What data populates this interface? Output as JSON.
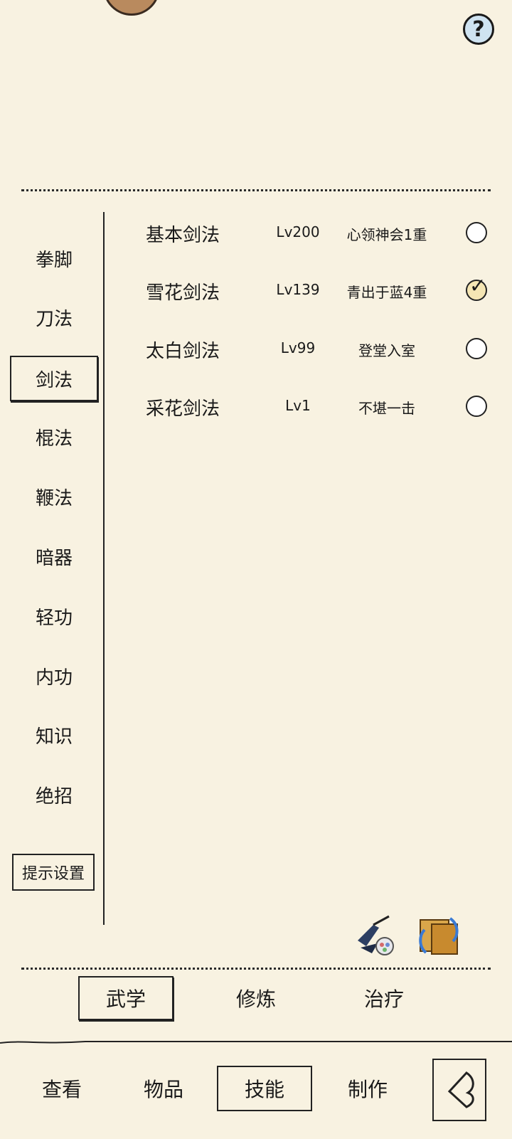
{
  "top": {
    "help_icon": "question-icon",
    "help_symbol": "?"
  },
  "sidebar": {
    "items": [
      {
        "label": "拳脚"
      },
      {
        "label": "刀法"
      },
      {
        "label": "剑法",
        "selected": true
      },
      {
        "label": "棍法"
      },
      {
        "label": "鞭法"
      },
      {
        "label": "暗器"
      },
      {
        "label": "轻功"
      },
      {
        "label": "内功"
      },
      {
        "label": "知识"
      },
      {
        "label": "绝招"
      }
    ],
    "hint_button": "提示设置"
  },
  "skills": [
    {
      "name": "基本剑法",
      "level": "Lv200",
      "rank": "心领神会1重",
      "checked": false
    },
    {
      "name": "雪花剑法",
      "level": "Lv139",
      "rank": "青出于蓝4重",
      "checked": true
    },
    {
      "name": "太白剑法",
      "level": "Lv99",
      "rank": "登堂入室",
      "checked": false
    },
    {
      "name": "采花剑法",
      "level": "Lv1",
      "rank": "不堪一击",
      "checked": false
    }
  ],
  "tools": {
    "left_icon": "swordsman-icon",
    "right_icon": "book-swap-icon"
  },
  "tabs": [
    {
      "label": "武学",
      "selected": true
    },
    {
      "label": "修炼"
    },
    {
      "label": "治疗"
    }
  ],
  "bottom_nav": [
    {
      "label": "查看"
    },
    {
      "label": "物品"
    },
    {
      "label": "技能",
      "selected": true
    },
    {
      "label": "制作"
    }
  ],
  "back_icon": "back-arrow-icon"
}
